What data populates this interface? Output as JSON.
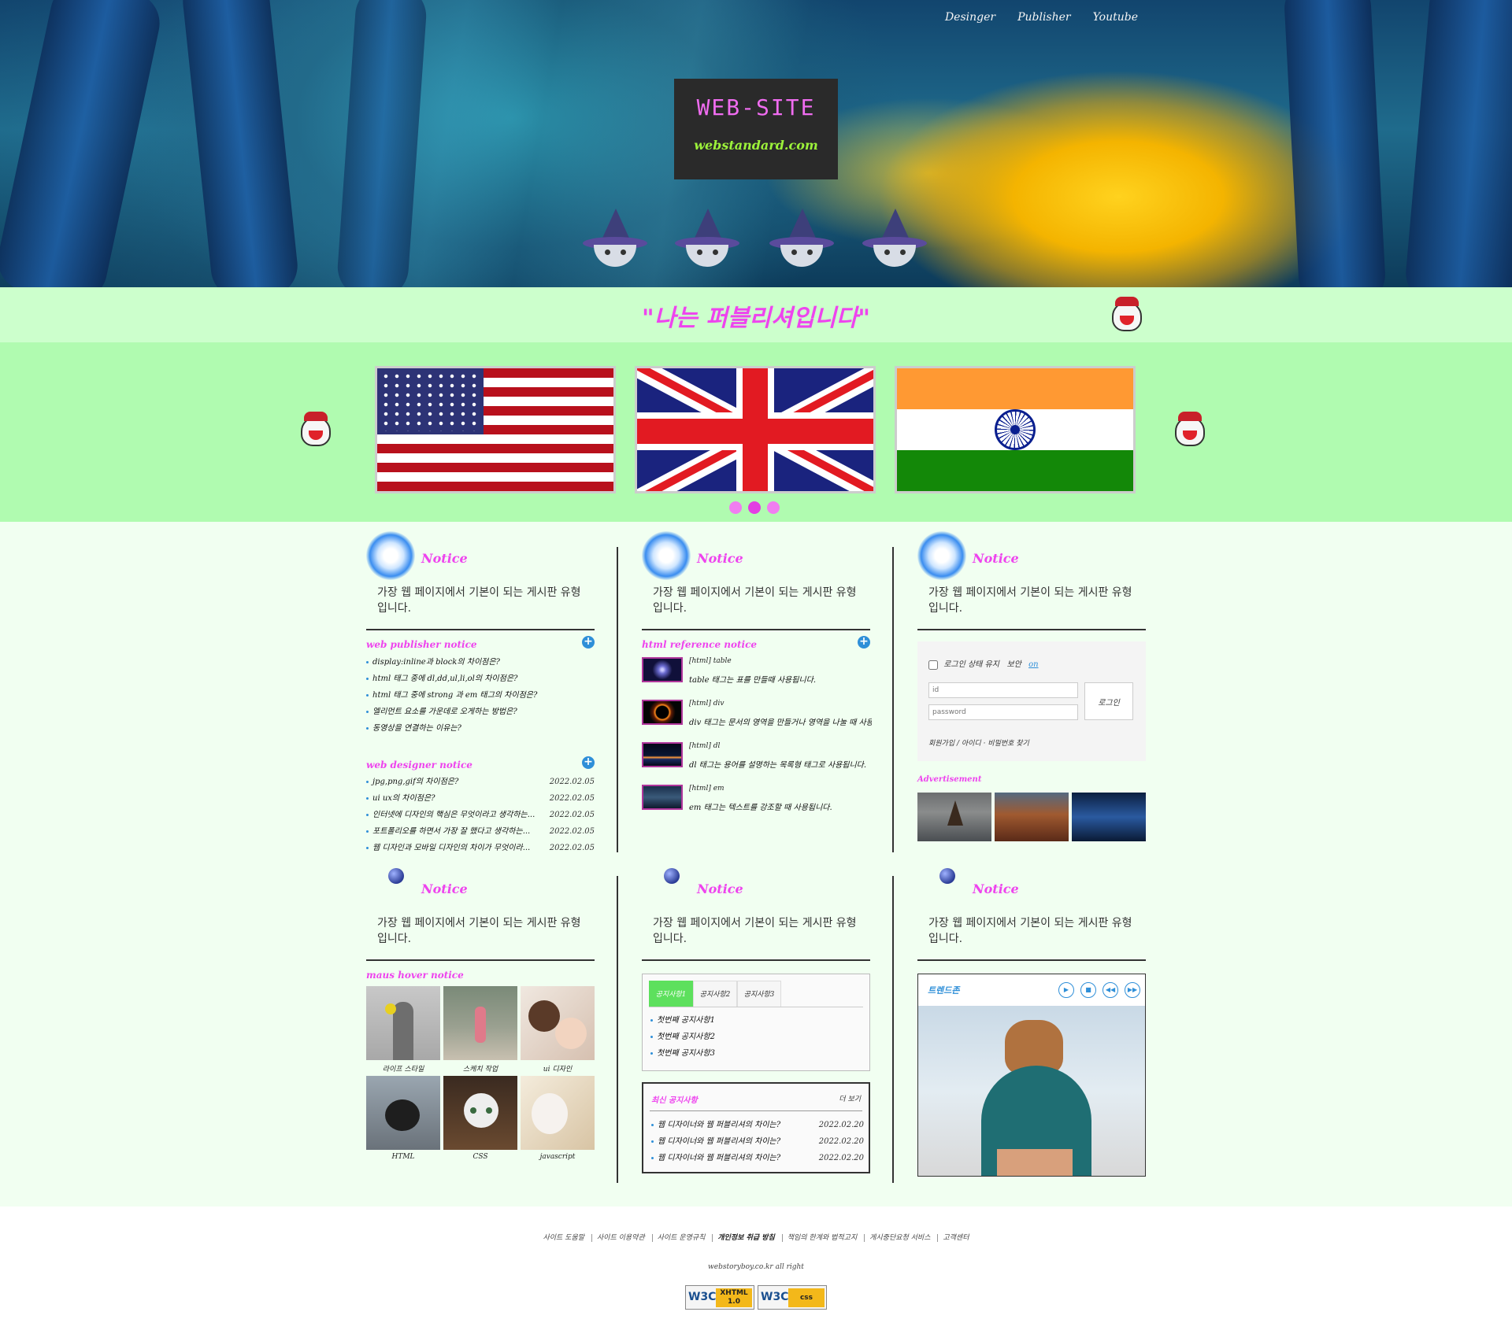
{
  "nav": [
    "Desinger",
    "Publisher",
    "Youtube"
  ],
  "logo": {
    "title": "WEB-SITE",
    "subtitle": "webstandard.com"
  },
  "slogan": "\"나는 퍼블리셔입니다\"",
  "slider": {
    "slides": [
      "united-states-flag",
      "united-kingdom-flag",
      "india-flag"
    ],
    "active_dot": 2
  },
  "columns": {
    "notice_title": "Notice",
    "notice_desc": "가장 웹 페이지에서 기본이 되는 게시판 유형입니다."
  },
  "publisher_notice": {
    "title": "web publisher notice",
    "items": [
      "display:inline과 block의 차이점은?",
      "html 태그 중에 dl,dd,ul,li,ol의 차이점은?",
      "html 태그 중에 strong 과 em 태그의 차이점은?",
      "엘리먼트 요소를 가운데로 오게하는 방법은?",
      "동영상을 연결하는 이유는?"
    ]
  },
  "designer_notice": {
    "title": "web designer notice",
    "items": [
      {
        "text": "jpg,png,gif의 차이점은?",
        "date": "2022.02.05"
      },
      {
        "text": "ui ux의 차이점은?",
        "date": "2022.02.05"
      },
      {
        "text": "인터넷에 디자인의 핵심은 무엇이라고 생각하는...",
        "date": "2022.02.05"
      },
      {
        "text": "포트폴리오를 하면서 가장 잘 했다고 생각하는...",
        "date": "2022.02.05"
      },
      {
        "text": "웹 디자인과 모바일 디자인의 차이가 무엇이라...",
        "date": "2022.02.05"
      }
    ]
  },
  "reference_notice": {
    "title": "html reference notice",
    "items": [
      {
        "tag": "[html] table",
        "desc": "table 태그는 표를 만들때 사용됩니다."
      },
      {
        "tag": "[html] div",
        "desc": "div 태그는 문서의 영역을 만들거나 영역을 나눌 때 사용..."
      },
      {
        "tag": "[html] dl",
        "desc": "dl 태그는 용어를 설명하는 목록형 태그로 사용됩니다."
      },
      {
        "tag": "[html] em",
        "desc": "em 태그는 텍스트를 강조할 때 사용됩니다."
      }
    ]
  },
  "login": {
    "keep_label": "로그인 상태 유지",
    "secure_label": "보안",
    "secure_state": "on",
    "id_placeholder": "id",
    "pw_placeholder": "password",
    "button": "로그인",
    "links": "회원가입 / 아이디 · 비밀번호 찾기"
  },
  "advertisement": {
    "title": "Advertisement"
  },
  "hover_notice": {
    "title": "maus hover notice",
    "items": [
      "라이프 스타일",
      "스케치 작업",
      "ui 디자인",
      "HTML",
      "CSS",
      "javascript"
    ]
  },
  "tabs": {
    "labels": [
      "공지사항1",
      "공지사항2",
      "공지사항3"
    ],
    "items": [
      "첫번째 공지사항1",
      "첫번째 공지사항2",
      "첫번째 공지사항3"
    ]
  },
  "latest_notice": {
    "title": "최신 공지사항",
    "more": "더 보기",
    "items": [
      {
        "text": "웹 디자이너와 웹 퍼블리셔의 차이는?",
        "date": "2022.02.20"
      },
      {
        "text": "웹 디자이너와 웹 퍼블리셔의 차이는?",
        "date": "2022.02.20"
      },
      {
        "text": "웹 디자이너와 웹 퍼블리셔의 차이는?",
        "date": "2022.02.20"
      }
    ]
  },
  "player": {
    "title": "트렌드존",
    "controls": [
      "play-icon",
      "stop-icon",
      "prev-icon",
      "next-icon"
    ]
  },
  "footer": {
    "links": [
      "사이트 도움말",
      "사이트 이용약관",
      "사이트 운영규칙",
      "개인정보 취급 방침",
      "책임의 한계와 법적고지",
      "게시중단요청 서비스",
      "고객센터"
    ],
    "copyright": "webstoryboy.co.kr all right",
    "badges": [
      {
        "left": "W3C",
        "right": "XHTML 1.0"
      },
      {
        "left": "W3C",
        "right": "css"
      }
    ]
  },
  "colors": {
    "accent_pink": "#ee44ee",
    "slogan_bg": "#ccffcc",
    "slider_bg": "#b0fbb0",
    "content_bg": "#f1fff1",
    "blue": "#2f8fd8"
  }
}
